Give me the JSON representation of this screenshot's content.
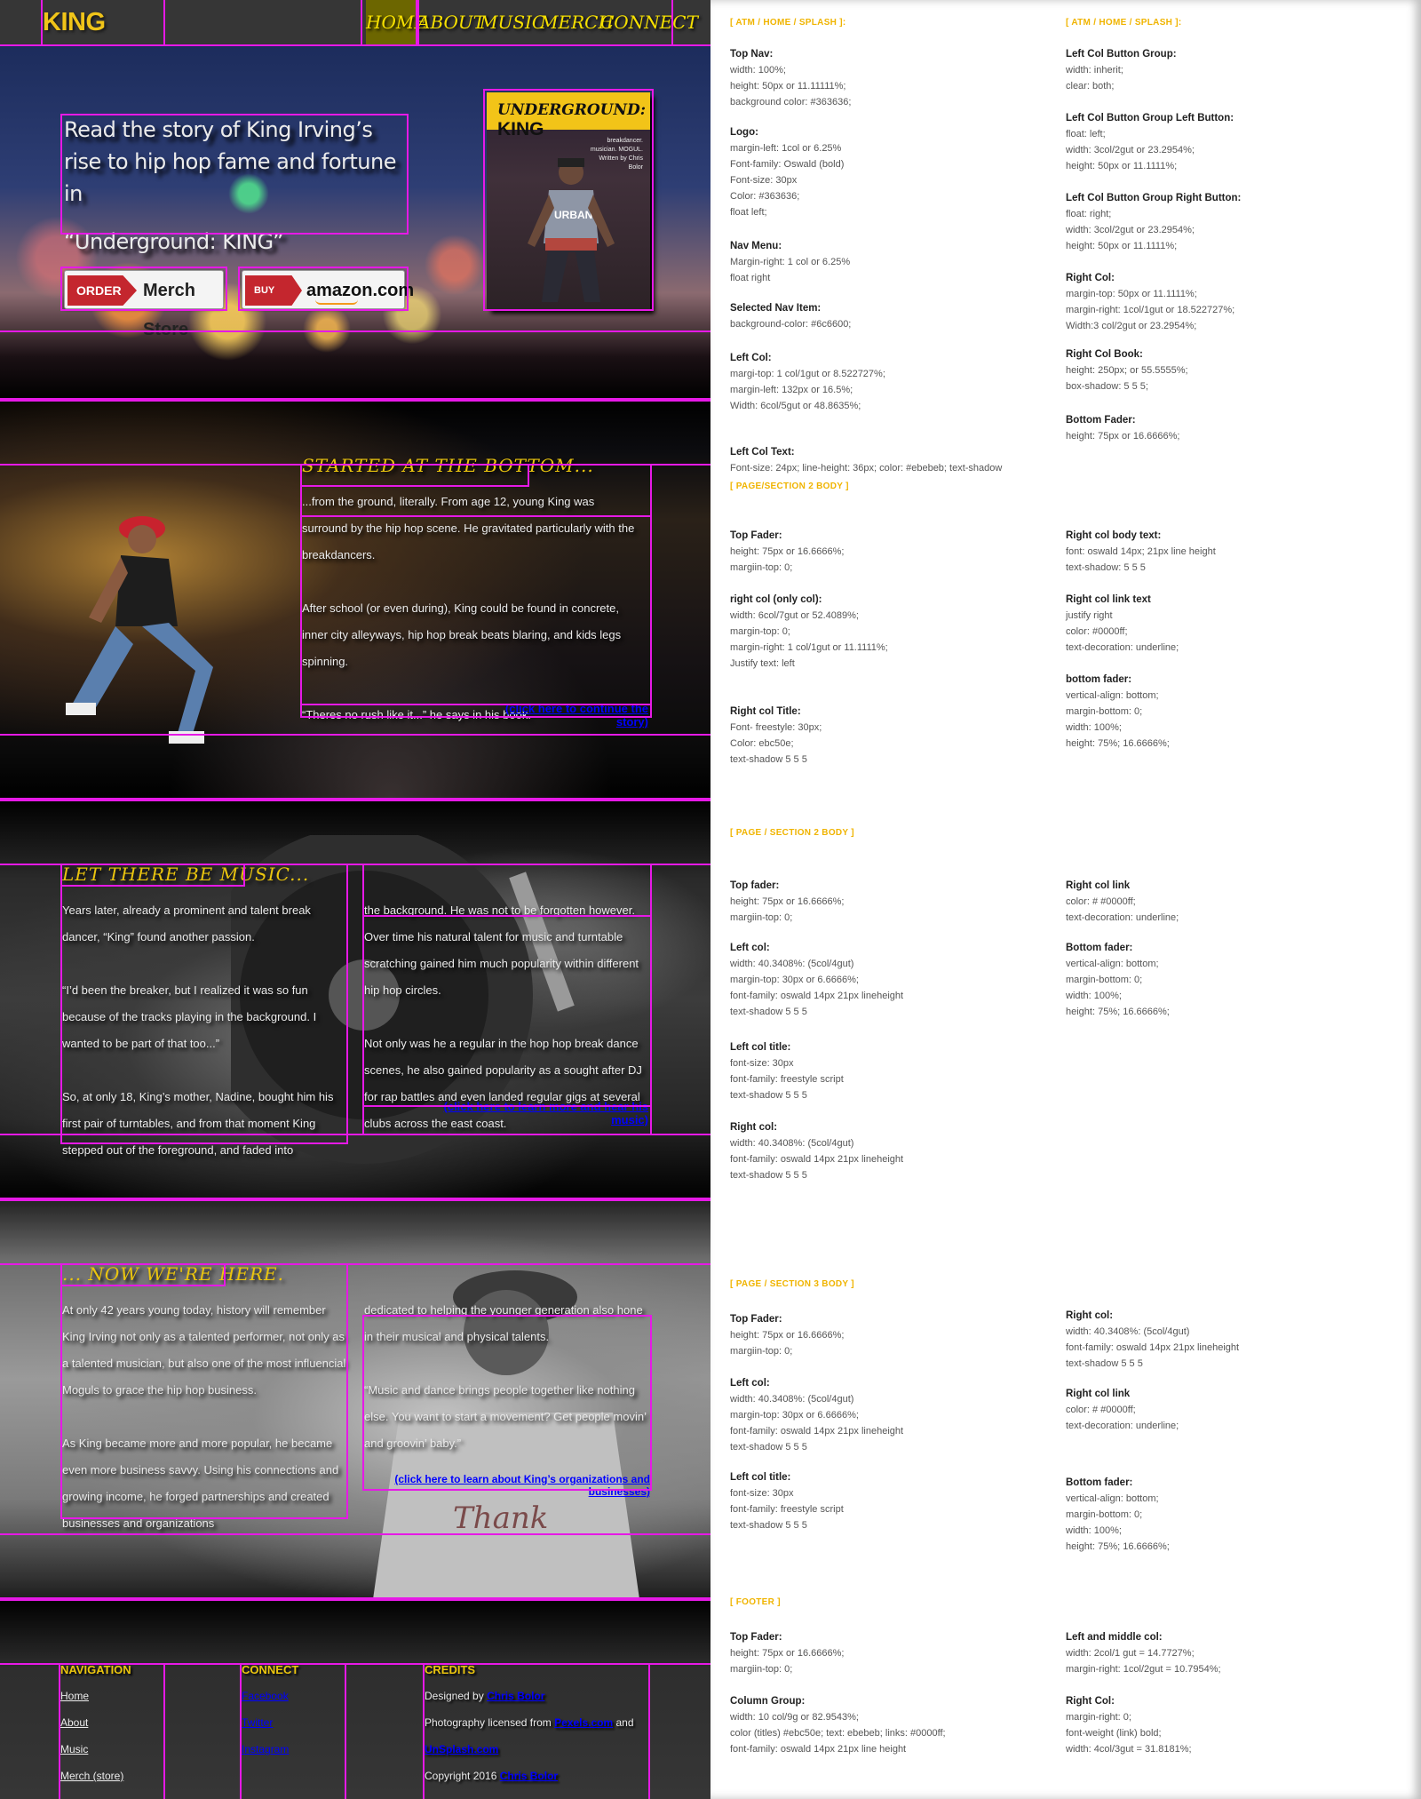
{
  "nav": {
    "logo": "KING IRVING",
    "items": [
      {
        "label": "HOME",
        "selected": true
      },
      {
        "label": "ABOUT",
        "selected": false
      },
      {
        "label": "MUSIC",
        "selected": false
      },
      {
        "label": "MERCH",
        "selected": false
      },
      {
        "label": "CONNECT",
        "selected": false
      }
    ]
  },
  "hero": {
    "line1": "Read the story of King Irving’s rise to hip hop fame and fortune in",
    "line2": "“Underground: KING”",
    "order_tag": "ORDER",
    "order_label": "Merch Store",
    "buy_tag": "BUY NOW",
    "buy_label": "amazon.com",
    "book_title_a": "UNDERGROUND:",
    "book_title_b": "KING",
    "book_subtitle": "breakdancer. musician. MOGUL. Written by Chris Bolor"
  },
  "section1": {
    "title": "STARTED AT THE BOTTOM...",
    "paragraphs": [
      "...from the ground, literally. From age 12, young King was surround by the hip hop scene. He gravitated particularly with the breakdancers.",
      "After school (or even during), King could be found in concrete, inner city alleyways, hip hop break beats blaring, and kids legs spinning.",
      "“Theres no rush like it...” he says in his book."
    ],
    "link": "(click here to continue the story)"
  },
  "section2": {
    "title": "LET THERE BE MUSIC...",
    "left": [
      "Years later, already a prominent and talent break dancer, “King” found another passion.",
      "“I’d been the breaker, but I realized it was so fun because of the tracks playing in the background. I wanted to be part of that too...”",
      "So, at only 18, King’s mother, Nadine, bought him his first pair of turntables, and from that moment King stepped out of the foreground, and faded into"
    ],
    "right": [
      "the background. He was not to be forgotten however. Over time his natural talent for music and turntable scratching gained him much popularity within different hip hop circles.",
      "Not only was he a regular in the hop hop break dance scenes, he also gained popularity as a sought after DJ for rap battles and even landed regular gigs at several clubs across the east coast."
    ],
    "link": "(click here to learn more and hear his music)"
  },
  "section3": {
    "title": "... NOW WE'RE HERE.",
    "left": [
      "At only 42 years young today, history will remember King Irving not only as a talented performer, not only as a talented musician, but also one of the most influencial Moguls to grace the hip hop business.",
      "As King became more and more popular, he became even more business savvy. Using his connections and growing income, he forged partnerships and created businesses and organizations"
    ],
    "right": [
      "dedicated to helping the younger generation also hone in their musical and physical talents.",
      "“Music and dance brings people together like nothing else. You want to start a movement? Get people movin’ and groovin’ baby.”"
    ],
    "link": "(click here to learn about King’s organizations and businesses)"
  },
  "footer": {
    "nav_title": "NAVIGATION",
    "nav_links": [
      "Home",
      "About",
      "Music",
      "Merch (store)"
    ],
    "connect_title": "CONNECT",
    "connect_links": [
      "Facebook",
      "Twitter",
      "Instagram"
    ],
    "credits_title": "CREDITS",
    "designed_by": "Designed by",
    "designer": "Chris Bolor",
    "photo_prefix": "Photography licensed from",
    "pexels": "Pexels.com",
    "and": "and",
    "unsplash": "UnSplash.com",
    "copyright": "Copyright 2016",
    "copyright_name": "Chris Bolor"
  },
  "spec": {
    "col1": [
      {
        "type": "header",
        "text": "[ ATM / HOME / SPLASH ]:"
      },
      {
        "type": "block",
        "title": "Top Nav:",
        "lines": [
          "width: 100%;",
          "height: 50px or 11.11111%;",
          "background color: #363636;"
        ]
      },
      {
        "type": "block",
        "title": "Logo:",
        "lines": [
          "margin-left: 1col or 6.25%",
          "Font-family: Oswald (bold)",
          "Font-size: 30px",
          "Color:  #363636;",
          "float left;"
        ]
      },
      {
        "type": "block",
        "title": "Nav Menu:",
        "lines": [
          "Margin-right: 1 col or 6.25%",
          "float right"
        ]
      },
      {
        "type": "block",
        "title": "Selected Nav Item:",
        "lines": [
          "background-color: #6c6600;"
        ]
      },
      {
        "type": "block",
        "title": "Left Col:",
        "lines": [
          "margi-top: 1 col/1gut or 8.522727%;",
          "margin-left: 132px or 16.5%;",
          "Width: 6col/5gut or 48.8635%;"
        ]
      },
      {
        "type": "block",
        "title": "Left Col Text:",
        "lines": [
          "Font-size: 24px; line-height: 36px; color: #ebebeb; text-shadow"
        ]
      },
      {
        "type": "header",
        "text": "[ PAGE/SECTION 2 BODY ]"
      },
      {
        "type": "block",
        "title": "Top Fader:",
        "lines": [
          "height: 75px or 16.6666%;",
          "margiin-top: 0;"
        ]
      },
      {
        "type": "block",
        "title": "right col (only col):",
        "lines": [
          "width: 6col/7gut or 52.4089%;",
          "margin-top: 0;",
          "margin-right: 1 col/1gut or 11.1111%;",
          "Justify text: left"
        ]
      },
      {
        "type": "block",
        "title": "Right col Title:",
        "lines": [
          "Font- freestyle: 30px;",
          "Color:  ebc50e;",
          "text-shadow 5 5 5"
        ]
      },
      {
        "type": "header",
        "text": "[ PAGE / SECTION 2 BODY ]"
      },
      {
        "type": "block",
        "title": "Top fader:",
        "lines": [
          "height: 75px or 16.6666%;",
          "margiin-top: 0;"
        ]
      },
      {
        "type": "block",
        "title": "Left col:",
        "lines": [
          "width: 40.3408%: (5col/4gut)",
          "margin-top: 30px or 6.6666%;",
          "font-family: oswald 14px 21px lineheight",
          "text-shadow 5 5 5"
        ]
      },
      {
        "type": "block",
        "title": "Left col title:",
        "lines": [
          "font-size: 30px",
          "font-family: freestyle script",
          "text-shadow 5 5 5"
        ]
      },
      {
        "type": "block",
        "title": "Right col:",
        "lines": [
          "width: 40.3408%: (5col/4gut)",
          "font-family: oswald 14px 21px lineheight",
          "text-shadow 5 5 5"
        ]
      },
      {
        "type": "header",
        "text": "[ PAGE / SECTION 3 BODY ]"
      },
      {
        "type": "block",
        "title": "Top Fader:",
        "lines": [
          "height: 75px or 16.6666%;",
          "margiin-top: 0;"
        ]
      },
      {
        "type": "block",
        "title": "Left col:",
        "lines": [
          "width: 40.3408%: (5col/4gut)",
          "margin-top: 30px or 6.6666%;",
          "font-family: oswald 14px 21px lineheight",
          "text-shadow 5 5 5"
        ]
      },
      {
        "type": "block",
        "title": "Left col title:",
        "lines": [
          "font-size: 30px",
          "font-family: freestyle script",
          "text-shadow 5 5 5"
        ]
      },
      {
        "type": "header",
        "text": "[ FOOTER ]"
      },
      {
        "type": "block",
        "title": "Top Fader:",
        "lines": [
          "height: 75px or 16.6666%;",
          "margiin-top: 0;"
        ]
      },
      {
        "type": "block",
        "title": "Column Group:",
        "lines": [
          "width: 10 col/9g or 82.9543%;",
          "color (titles)  #ebc50e; text: ebebeb; links: #0000ff;",
          "font-family: oswald 14px 21px line height"
        ]
      }
    ],
    "col2": [
      {
        "type": "header",
        "text": "[ ATM / HOME / SPLASH ]:"
      },
      {
        "type": "block",
        "title": "Left Col Button Group:",
        "lines": [
          "width: inherit;",
          "clear: both;"
        ]
      },
      {
        "type": "block",
        "title": "Left Col Button Group Left Button:",
        "lines": [
          "float: left;",
          "width: 3col/2gut or 23.2954%;",
          "height: 50px or 11.1111%;"
        ]
      },
      {
        "type": "block",
        "title": "Left Col Button Group Right Button:",
        "lines": [
          "float: right;",
          "width: 3col/2gut or 23.2954%;",
          "height: 50px or 11.1111%;"
        ]
      },
      {
        "type": "block",
        "title": "Right Col:",
        "lines": [
          "margin-top:  50px or 11.1111%;",
          "margin-right: 1col/1gut or 18.522727%;",
          "Width:3 col/2gut or 23.2954%;"
        ]
      },
      {
        "type": "block",
        "title": "Right Col Book:",
        "lines": [
          "height: 250px; or 55.5555%;",
          "box-shadow: 5 5 5;"
        ]
      },
      {
        "type": "block",
        "title": "Bottom Fader:",
        "lines": [
          "height: 75px or 16.6666%;"
        ]
      },
      {
        "type": "block",
        "title": "Right col body text:",
        "lines": [
          "font: oswald 14px; 21px line height",
          "text-shadow: 5 5 5"
        ]
      },
      {
        "type": "block",
        "title": "Right col link text",
        "lines": [
          "justify right",
          "color: #0000ff;",
          "text-decoration: underline;"
        ]
      },
      {
        "type": "block",
        "title": "bottom fader:",
        "lines": [
          "vertical-align: bottom;",
          "margin-bottom: 0;",
          "width: 100%;",
          "height: 75%; 16.6666%;"
        ]
      },
      {
        "type": "block",
        "title": "Right col link",
        "lines": [
          "color: # #0000ff;",
          "text-decoration: underline;"
        ]
      },
      {
        "type": "block",
        "title": "Bottom fader:",
        "lines": [
          "vertical-align: bottom;",
          "margin-bottom: 0;",
          "width: 100%;",
          "height: 75%; 16.6666%;"
        ]
      },
      {
        "type": "block",
        "title": "Right col:",
        "lines": [
          "width: 40.3408%: (5col/4gut)",
          "font-family: oswald 14px 21px lineheight",
          "text-shadow 5 5 5"
        ]
      },
      {
        "type": "block",
        "title": "Right col link",
        "lines": [
          "color: # #0000ff;",
          "text-decoration: underline;"
        ]
      },
      {
        "type": "block",
        "title": "Bottom fader:",
        "lines": [
          "vertical-align: bottom;",
          "margin-bottom: 0;",
          "width: 100%;",
          "height: 75%; 16.6666%;"
        ]
      },
      {
        "type": "block",
        "title": "Left and middle col:",
        "lines": [
          "width: 2col/1 gut = 14.7727%;",
          "margin-right: 1col/2gut = 10.7954%;"
        ]
      },
      {
        "type": "block",
        "title": "Right Col:",
        "lines": [
          "margin-right: 0;",
          "font-weight (link) bold;",
          "width: 4col/3gut = 31.8181%;"
        ]
      }
    ]
  }
}
